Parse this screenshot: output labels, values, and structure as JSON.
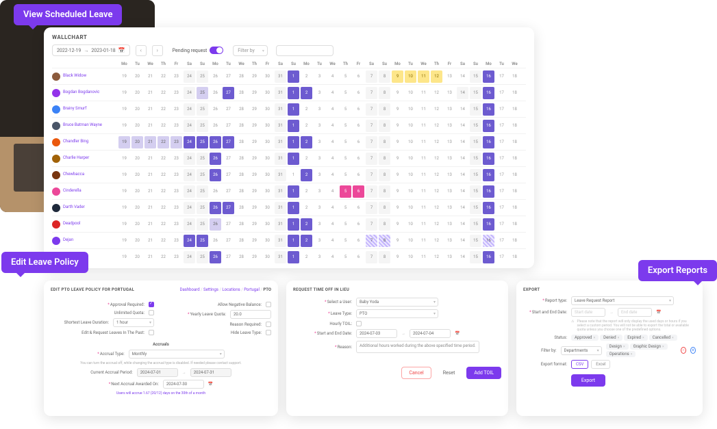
{
  "tags": {
    "view": "View Scheduled Leave",
    "edit": "Edit Leave Policy",
    "export": "Export Reports"
  },
  "wallchart": {
    "title": "WALLCHART",
    "date_from": "2022-12-19",
    "date_to": "2023-01-18",
    "pending_label": "Pending request",
    "filter_label": "Filter by",
    "days": [
      "Mo",
      "Tu",
      "We",
      "Th",
      "Fr",
      "Sa",
      "Su",
      "Mo",
      "Tu",
      "We",
      "Th",
      "Fr",
      "Sa",
      "Su",
      "Mo",
      "Tu",
      "We",
      "Th",
      "Fr",
      "Sa",
      "Su",
      "Mo",
      "Tu",
      "We",
      "Th",
      "Fr",
      "Sa",
      "Su",
      "Mo",
      "Tu",
      "We"
    ],
    "dates": [
      19,
      20,
      21,
      22,
      23,
      24,
      25,
      26,
      27,
      28,
      29,
      30,
      31,
      1,
      2,
      3,
      4,
      5,
      6,
      7,
      8,
      9,
      10,
      11,
      12,
      13,
      14,
      15,
      16,
      17,
      18
    ],
    "employees": [
      {
        "name": "Black Widow",
        "color": "#8b5a3c",
        "cells": [
          "",
          "",
          "",
          "",
          "",
          "wk",
          "wk",
          "",
          "",
          "",
          "",
          "",
          "wk",
          "pur",
          "",
          "",
          "",
          "",
          "",
          "wk",
          "wk",
          "yel",
          "yel",
          "yel",
          "yel",
          "",
          "",
          "wk",
          "pur",
          "",
          ""
        ]
      },
      {
        "name": "Bogdan Bogdanovic",
        "color": "#9333ea",
        "cells": [
          "",
          "",
          "",
          "",
          "",
          "wk",
          "purl",
          "",
          "pur",
          "",
          "",
          "",
          "wk",
          "pur",
          "pur",
          "",
          "",
          "",
          "",
          "wk",
          "wk",
          "",
          "",
          "",
          "",
          "",
          "wk",
          "wk",
          "pur",
          "",
          ""
        ]
      },
      {
        "name": "Brainy Smurf",
        "color": "#3b82f6",
        "cells": [
          "",
          "",
          "",
          "",
          "",
          "wk",
          "wk",
          "",
          "",
          "",
          "",
          "",
          "wk",
          "pur",
          "",
          "",
          "",
          "",
          "",
          "wk",
          "wk",
          "",
          "",
          "",
          "",
          "",
          "",
          "wk",
          "pur",
          "",
          ""
        ]
      },
      {
        "name": "Bruce Batman Wayne",
        "color": "#4a5568",
        "cells": [
          "",
          "",
          "",
          "",
          "",
          "wk",
          "wk",
          "",
          "",
          "",
          "",
          "",
          "wk",
          "pur",
          "",
          "",
          "",
          "",
          "",
          "wk",
          "wk",
          "",
          "",
          "",
          "",
          "",
          "",
          "wk",
          "pur",
          "",
          ""
        ]
      },
      {
        "name": "Chandler Bing",
        "color": "#ea580c",
        "cells": [
          "purl",
          "purl",
          "purl",
          "purl",
          "purl",
          "pur",
          "pur",
          "pur",
          "pur",
          "",
          "",
          "",
          "wk",
          "pur",
          "pur",
          "",
          "",
          "",
          "",
          "wk",
          "wk",
          "",
          "",
          "",
          "",
          "",
          "",
          "wk",
          "pur",
          "",
          ""
        ]
      },
      {
        "name": "Charlie Harper",
        "color": "#a16207",
        "cells": [
          "",
          "",
          "",
          "",
          "",
          "wk",
          "wk",
          "pur",
          "",
          "",
          "",
          "",
          "wk",
          "pur",
          "",
          "",
          "",
          "",
          "",
          "wk",
          "wk",
          "",
          "",
          "",
          "",
          "",
          "",
          "wk",
          "pur",
          "",
          ""
        ]
      },
      {
        "name": "Chewbacca",
        "color": "#78350f",
        "cells": [
          "",
          "",
          "",
          "",
          "",
          "wk",
          "wk",
          "pur",
          "",
          "",
          "",
          "",
          "wk",
          "",
          "pur",
          "",
          "",
          "",
          "",
          "wk",
          "wk",
          "",
          "",
          "",
          "",
          "",
          "",
          "wk",
          "pur",
          "",
          ""
        ]
      },
      {
        "name": "Cinderella",
        "color": "#ec4899",
        "cells": [
          "",
          "",
          "",
          "",
          "",
          "wk",
          "wk",
          "",
          "",
          "",
          "",
          "",
          "wk",
          "pur",
          "",
          "",
          "",
          "pink",
          "pink",
          "wk",
          "wk",
          "",
          "",
          "",
          "",
          "",
          "",
          "wk",
          "pur",
          "",
          ""
        ]
      },
      {
        "name": "Darth Vader",
        "color": "#1e293b",
        "cells": [
          "",
          "",
          "",
          "",
          "",
          "wk",
          "wk",
          "pur",
          "pur",
          "",
          "",
          "",
          "wk",
          "pur",
          "",
          "",
          "",
          "",
          "",
          "wk",
          "wk",
          "",
          "",
          "",
          "",
          "",
          "",
          "wk",
          "pur",
          "",
          ""
        ]
      },
      {
        "name": "Deadpool",
        "color": "#dc2626",
        "cells": [
          "",
          "",
          "",
          "",
          "",
          "wk",
          "wk",
          "purl",
          "",
          "",
          "",
          "",
          "wk",
          "pur",
          "pur",
          "",
          "",
          "",
          "",
          "wk",
          "wk",
          "",
          "",
          "",
          "",
          "",
          "",
          "wk",
          "pur",
          "",
          ""
        ]
      },
      {
        "name": "Dejan",
        "color": "#7c3aed",
        "cells": [
          "",
          "",
          "",
          "",
          "",
          "pur",
          "pur",
          "",
          "",
          "",
          "",
          "",
          "wk",
          "pur",
          "pur",
          "",
          "",
          "",
          "",
          "hatch",
          "hatch",
          "",
          "",
          "",
          "",
          "",
          "",
          "wk",
          "hatch",
          "",
          ""
        ]
      },
      {
        "name": "",
        "color": "#94a3b8",
        "cells": [
          "",
          "",
          "",
          "",
          "",
          "wk",
          "wk",
          "pur",
          "",
          "",
          "",
          "",
          "wk",
          "pur",
          "",
          "",
          "",
          "",
          "",
          "wk",
          "wk",
          "",
          "",
          "",
          "",
          "",
          "",
          "wk",
          "pur",
          "",
          ""
        ]
      }
    ]
  },
  "policy": {
    "title": "EDIT PTO LEAVE POLICY FOR PORTUGAL",
    "crumbs": [
      "Dashboard",
      "Settings",
      "Locations",
      "Portugal",
      "PTO"
    ],
    "approval": "Approval Required:",
    "neg_balance": "Allow Negative Balance:",
    "unlimited": "Unlimited Quota:",
    "yearly": "Yearly Leave Quota:",
    "yearly_val": "20.0",
    "shortest": "Shortest Leave Duration:",
    "shortest_val": "1 hour",
    "reason": "Reason Required:",
    "edit_past": "Edit & Request Leaves In The Past:",
    "hide_type": "Hide Leave Type:",
    "accruals": "Accruals",
    "accrual_type_lbl": "Accrual Type:",
    "accrual_type_val": "Monthly",
    "accrual_hint": "You can turn the accrual off, while changing the accrual type is disabled. If needed please contact support.",
    "period_lbl": "Current Accrual Period:",
    "period_from": "2024-07-01",
    "period_to": "2024-07-31",
    "next_lbl": "Next Accrual Awarded On:",
    "next_val": "2024-07-30",
    "summary": "Users will accrue 1.67 (20/12) days on the 30th of a month"
  },
  "toil": {
    "title": "REQUEST TIME OFF IN LIEU",
    "user_lbl": "Select a User:",
    "user_val": "Baby Yoda",
    "type_lbl": "Leave Type:",
    "type_val": "PTO",
    "hourly_lbl": "Hourly TOIL:",
    "date_lbl": "Start and End Date:",
    "date_from": "2024-07-03",
    "date_to": "2024-07-04",
    "reason_lbl": "Reason:",
    "reason_val": "Additional hours worked during the above specified time period.",
    "cancel": "Cancel",
    "reset": "Reset",
    "add": "Add TOIL"
  },
  "export": {
    "title": "EXPORT",
    "type_lbl": "Report type:",
    "type_val": "Leave Request Report",
    "date_lbl": "Start and End Date:",
    "date_from": "Start date",
    "date_to": "End date",
    "warn": "Please note that the report will only display the used days or hours if you select a custom period. You will not be able to export the total or available quota unless you choose one of the predefined options.",
    "status_lbl": "Status:",
    "status": [
      "Approved",
      "Denied",
      "Expired",
      "Cancelled"
    ],
    "filter_lbl": "Filter by:",
    "filter_by": "Departments",
    "filters": [
      "Design",
      "Graphic Design",
      "Operations"
    ],
    "fmt_lbl": "Export format:",
    "fmt_csv": "CSV",
    "fmt_excel": "Excel",
    "export_btn": "Export"
  }
}
